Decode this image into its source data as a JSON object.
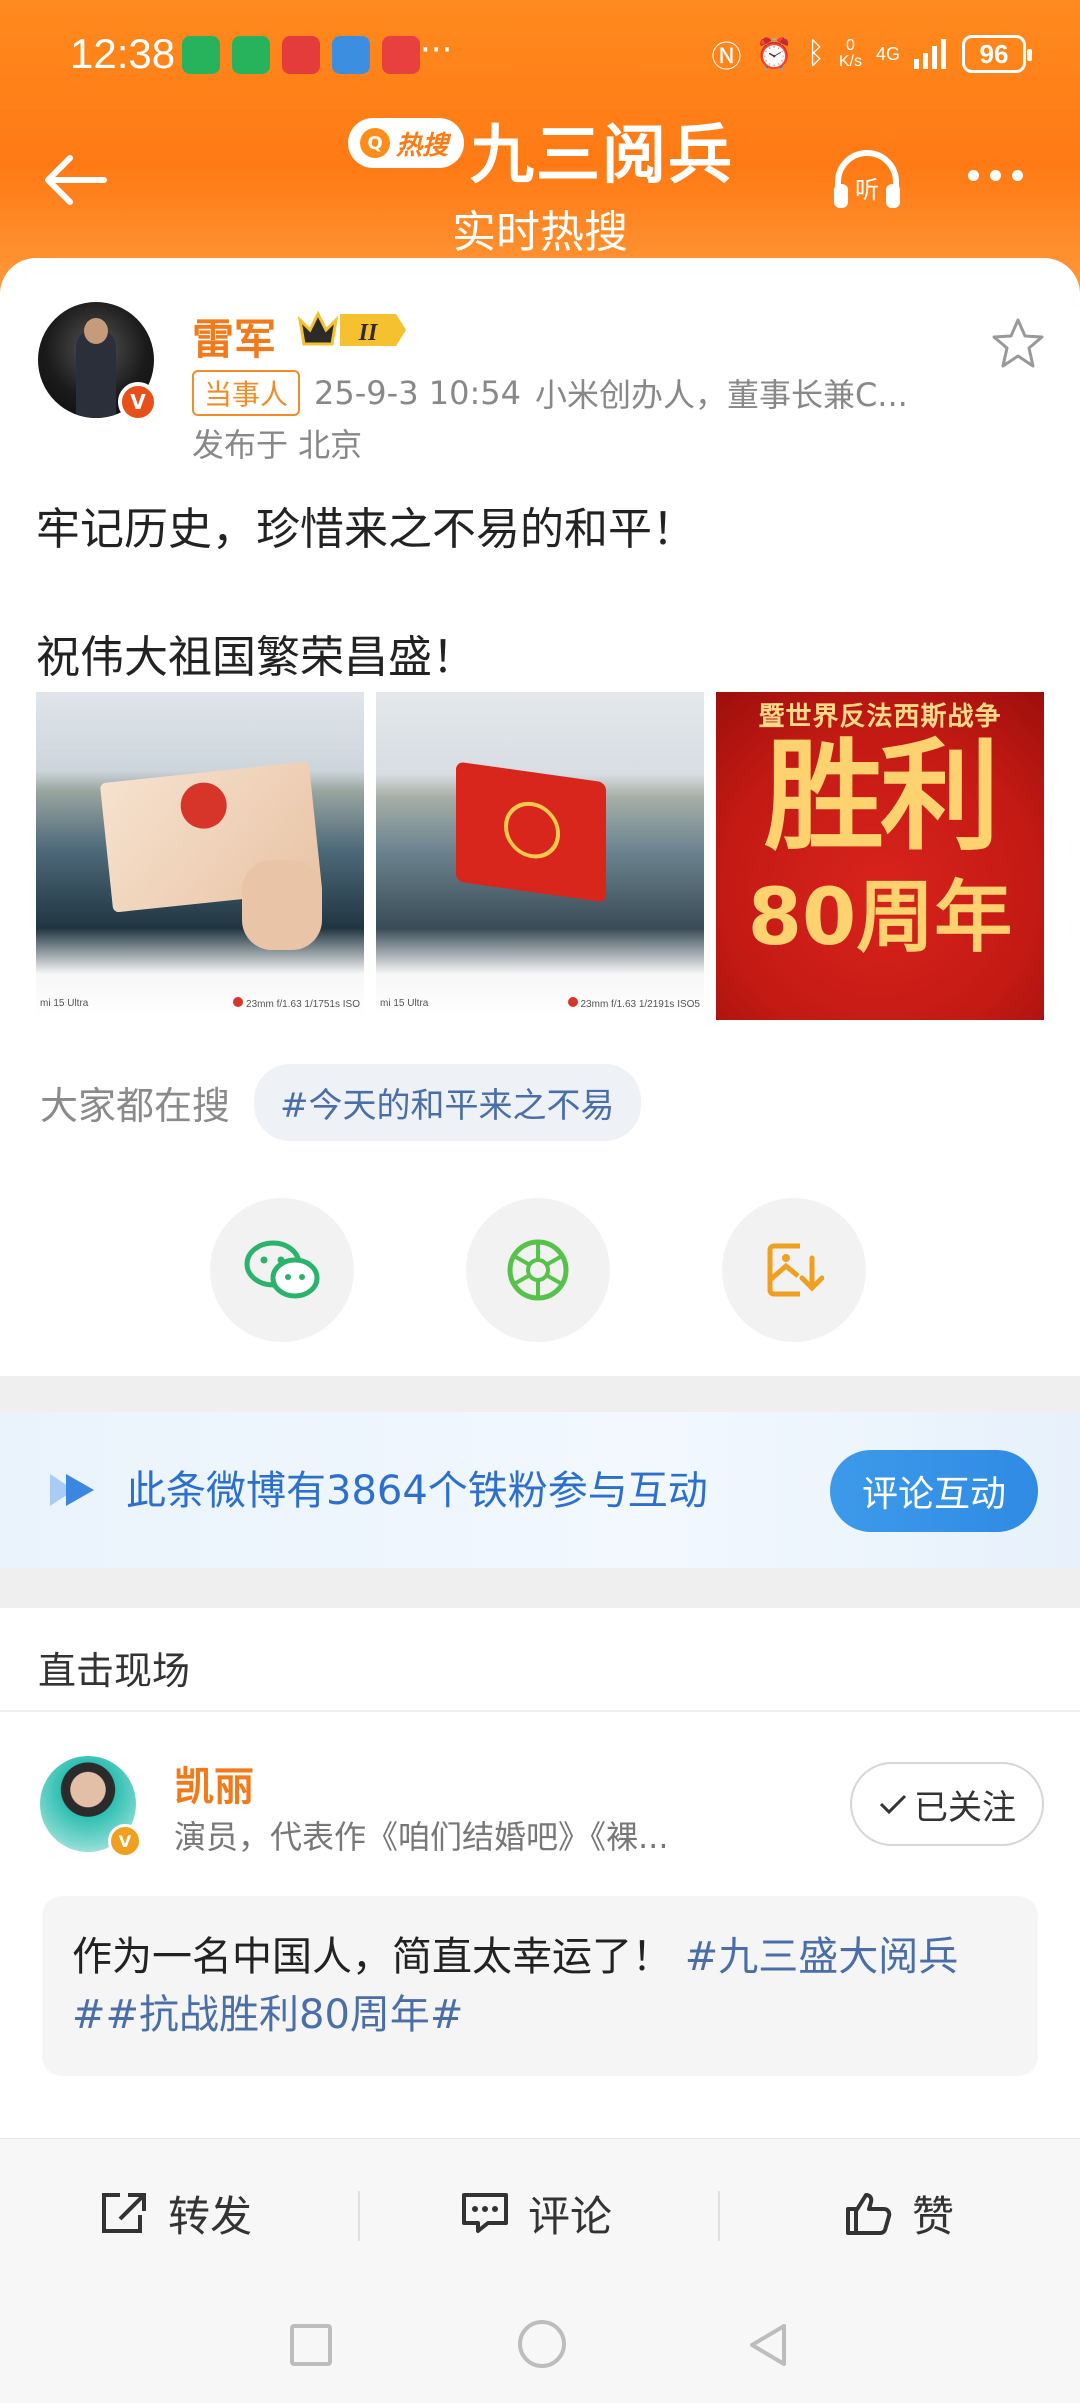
{
  "status_bar": {
    "time": "12:38",
    "more_dots": "···",
    "net_speed_top": "0",
    "net_speed_bottom": "K/s",
    "network": "4G",
    "battery": "96"
  },
  "header": {
    "hot_badge": "热搜",
    "title": "九三阅兵",
    "subtitle": "实时热搜",
    "accent": "#ff7a14"
  },
  "post": {
    "username": "雷军",
    "level": "II",
    "tag": "当事人",
    "time": "25-9-3 10:54",
    "bio": "小米创办人，董事长兼C...",
    "location": "发布于 北京",
    "text_line1": "牢记历史，珍惜来之不易的和平！",
    "text_line2": "祝伟大祖国繁荣昌盛！",
    "images": [
      {
        "exif_left": "mi 15 Ultra",
        "exif_right": "23mm  f/1.63  1/1751s  ISO"
      },
      {
        "exif_left": "mi 15 Ultra",
        "exif_right": "23mm  f/1.63  1/2191s  ISO5"
      },
      {
        "line1": "暨世界反法西斯战争",
        "line2": "胜利",
        "line3": "80周年"
      }
    ],
    "search_label": "大家都在搜",
    "search_chip": "#今天的和平来之不易"
  },
  "fans": {
    "text": "此条微博有3864个铁粉参与互动",
    "button": "评论互动",
    "color": "#2d6fcc"
  },
  "live": {
    "section_title": "直击现场",
    "name": "凯丽",
    "desc": "演员，代表作《咱们结婚吧》《裸...",
    "follow_label": "已关注",
    "quote_text": "作为一名中国人，简直太幸运了！ ",
    "quote_tags": "#九三盛大阅兵##抗战胜利80周年#"
  },
  "actions": {
    "repost": "转发",
    "comment": "评论",
    "like": "赞"
  }
}
